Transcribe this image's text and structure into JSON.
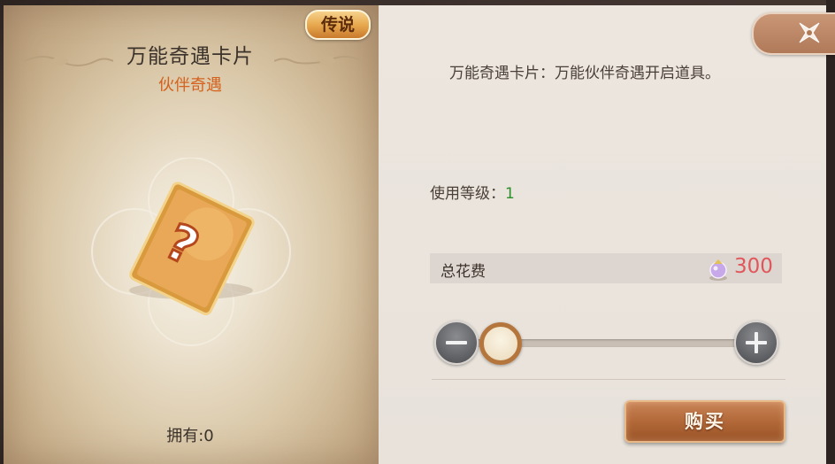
{
  "item": {
    "tier": "传说",
    "name": "万能奇遇卡片",
    "category": "伙伴奇遇",
    "owned": "拥有:0",
    "icon": "question-card-icon"
  },
  "details": {
    "description": "万能奇遇卡片：万能伙伴奇遇开启道具。",
    "level_label": "使用等级：",
    "level_value": "1"
  },
  "cost": {
    "label": "总花费",
    "currency_icon": "gem-currency-icon",
    "value": "300"
  },
  "quantity": {
    "fraction": 0
  },
  "buy_label": "购买",
  "colors": {
    "tier_badge": "#e8a94f",
    "category": "#d4621e",
    "level_value": "#2c8f2c",
    "cost_value": "#e0575b",
    "buy_button": "#b06636"
  }
}
